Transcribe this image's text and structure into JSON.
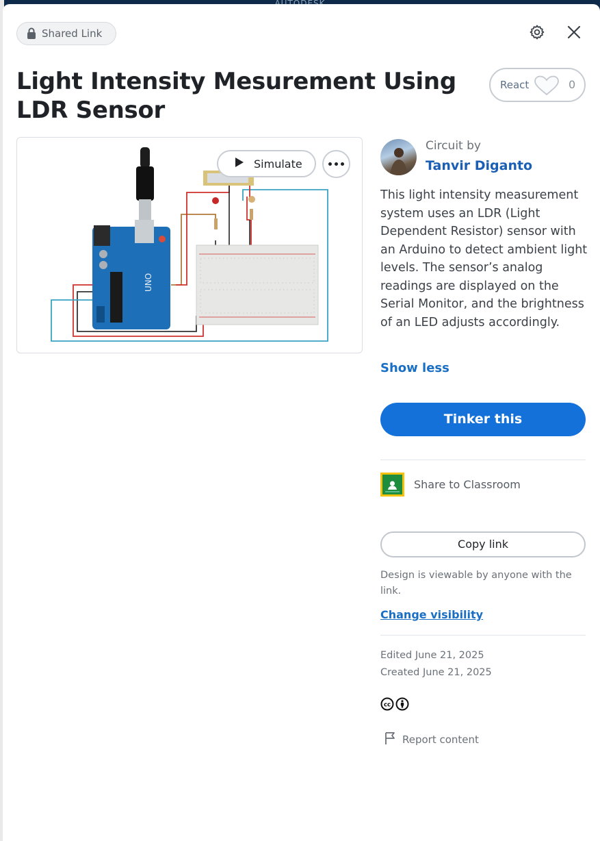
{
  "backdrop": {
    "brand": "AUTODESK"
  },
  "header": {
    "visibility_label": "Shared Link",
    "settings_icon": "gear-icon",
    "close_icon": "close-icon"
  },
  "design": {
    "title": "Light Intensity Mesurement Using LDR Sensor",
    "react_label": "React",
    "react_count": "0",
    "simulate_label": "Simulate"
  },
  "author": {
    "label": "Circuit by",
    "name": "Tanvir Diganto"
  },
  "description": "This light intensity measurement system uses an LDR (Light Dependent Resistor) sensor with an Arduino to detect ambient light levels. The sensor’s analog readings are displayed on the Serial Monitor, and the brightness of an LED adjusts accordingly.",
  "actions": {
    "show_less": "Show less",
    "tinker": "Tinker this",
    "share_classroom": "Share to Classroom",
    "copy_link": "Copy link",
    "viewable_note": "Design is viewable by anyone with the link.",
    "change_visibility": "Change visibility"
  },
  "meta": {
    "edited": "Edited June 21, 2025",
    "created": "Created June 21, 2025",
    "report": "Report content"
  },
  "colors": {
    "accent": "#1471d9",
    "link": "#1a6fc4",
    "arduino": "#1d6fb8",
    "wire_red": "#d0312d",
    "wire_teal": "#3ba3c4"
  }
}
